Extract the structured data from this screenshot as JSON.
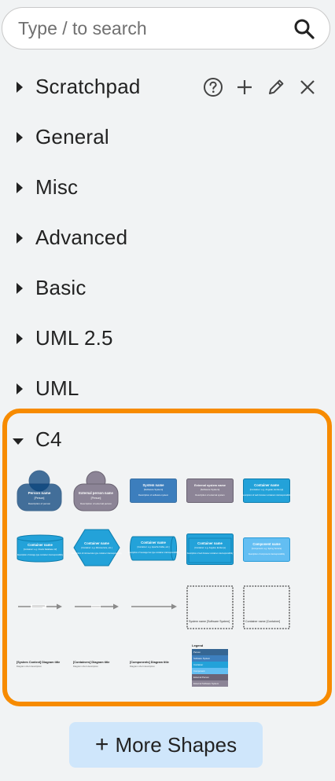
{
  "search": {
    "placeholder": "Type / to search"
  },
  "sections": {
    "scratchpad": "Scratchpad",
    "general": "General",
    "misc": "Misc",
    "advanced": "Advanced",
    "basic": "Basic",
    "uml25": "UML 2.5",
    "uml": "UML",
    "c4": "C4"
  },
  "c4_shapes": {
    "person": {
      "name": "Person name",
      "type": "[Person]",
      "desc": "Description of person"
    },
    "external_person": {
      "name": "External person name",
      "type": "[Person]",
      "desc": "Description of external person"
    },
    "system": {
      "name": "System name",
      "type": "[Software System]",
      "desc": "Description of software system"
    },
    "external_system": {
      "name": "External system name",
      "type": "[Software System]",
      "desc": "Description of external system"
    },
    "container_db": {
      "name": "Container name",
      "type": "[Container: e.g. Oracle Database 12]",
      "desc": "Description of storage type container role/responsibility"
    },
    "container_hex": {
      "name": "Container name",
      "type": "[Container: e.g. Microservice, etc.]",
      "desc": "Description of microservice type container role/responsibility"
    },
    "container_queue": {
      "name": "Container name",
      "type": "[Container: e.g. Apache Kafka, etc.]",
      "desc": "Description of message bus type container role/responsibility"
    },
    "container_web": {
      "name": "Container name",
      "type": "[Container: e.g. Angular, Ember.js]",
      "desc": "Description of web browser container role/responsibility"
    },
    "component": {
      "name": "Component name",
      "type": "[Component: e.g. Spring Service]",
      "desc": "Description of component role/responsibility"
    },
    "system_boundary": "System name\n[Software System]",
    "container_boundary": "Container name\n[Container]",
    "context_title": "[System Context] Diagram title",
    "container_title": "[Containers] Diagram title",
    "component_title": "[Components] Diagram title",
    "diagram_desc": "Diagram short description",
    "legend": {
      "title": "Legend",
      "rows": [
        "Person",
        "Software System",
        "Container",
        "Component",
        "External Person",
        "External Software System"
      ]
    }
  },
  "colors": {
    "accent_border": "#f78b00",
    "person": "#08427b",
    "external": "#8c8496",
    "system": "#1061b0",
    "container": "#23a2d9",
    "component": "#63bef2"
  },
  "more_shapes": {
    "label": "More Shapes"
  }
}
